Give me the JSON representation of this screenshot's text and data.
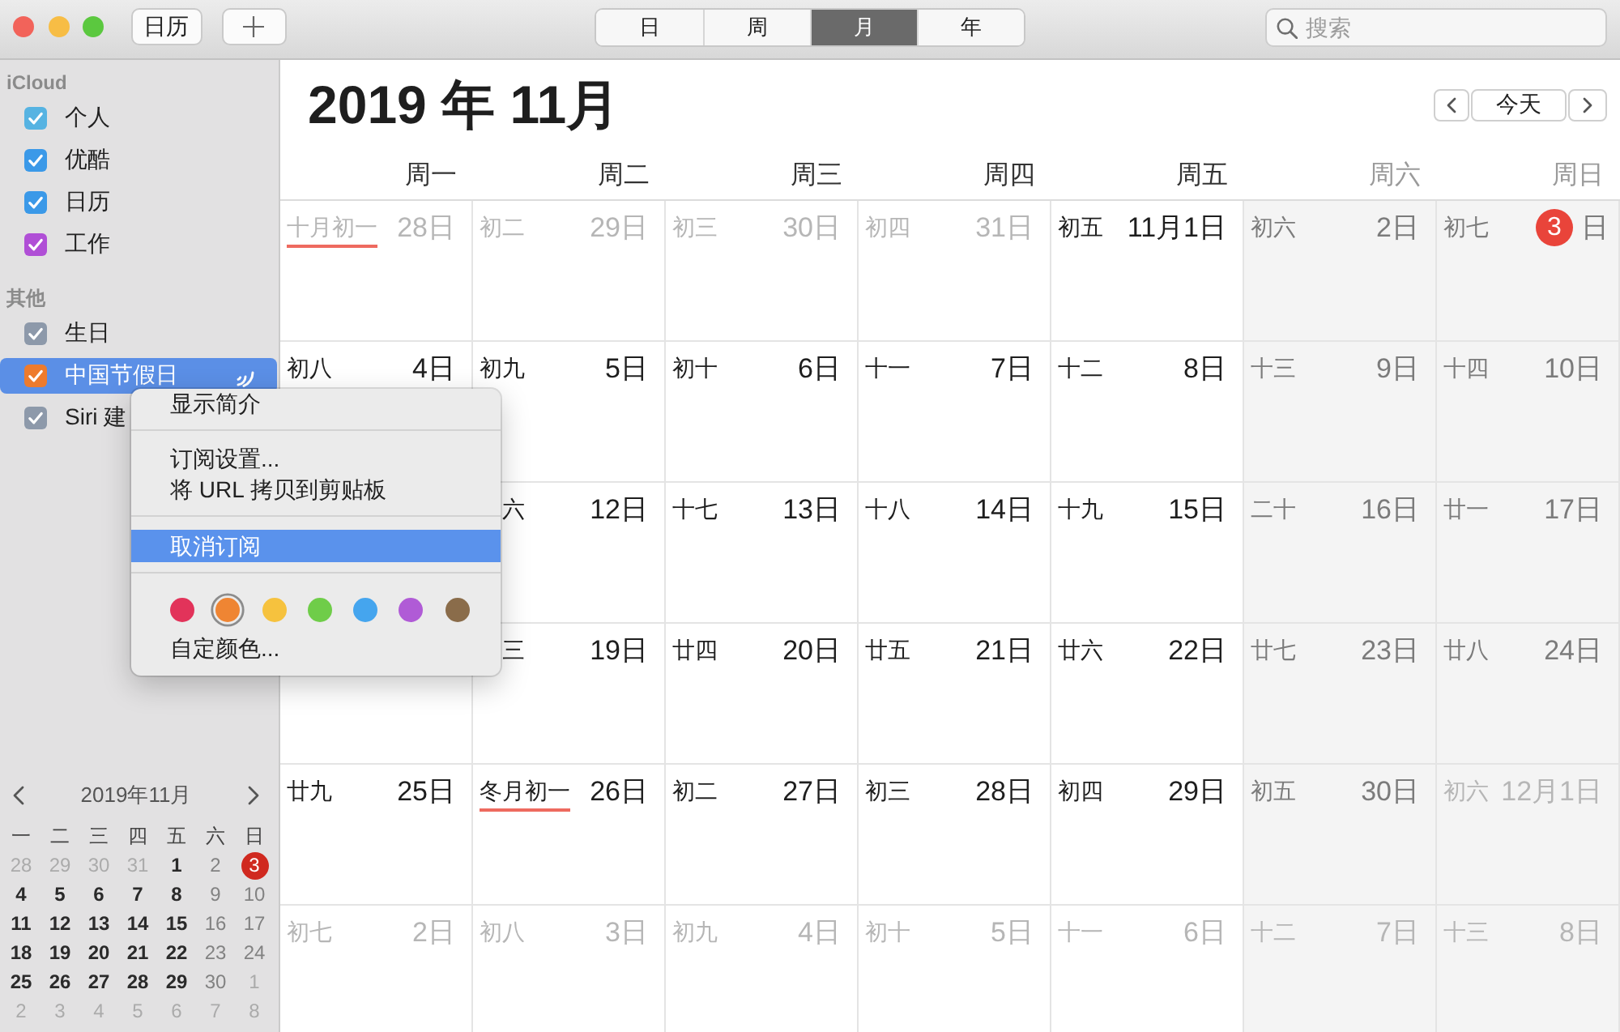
{
  "toolbar": {
    "calendars_button": "日历",
    "view_tabs": [
      {
        "label": "日",
        "selected": false
      },
      {
        "label": "周",
        "selected": false
      },
      {
        "label": "月",
        "selected": true
      },
      {
        "label": "年",
        "selected": false
      }
    ],
    "search": {
      "placeholder": "搜索"
    }
  },
  "sidebar": {
    "groups": [
      {
        "title": "iCloud",
        "items": [
          {
            "label": "个人",
            "checked": true,
            "color": "#56b3e2",
            "selected": false,
            "subscribed": false
          },
          {
            "label": "优酷",
            "checked": true,
            "color": "#3b99e8",
            "selected": false,
            "subscribed": false
          },
          {
            "label": "日历",
            "checked": true,
            "color": "#3b99e8",
            "selected": false,
            "subscribed": false
          },
          {
            "label": "工作",
            "checked": true,
            "color": "#b04fd6",
            "selected": false,
            "subscribed": false
          }
        ]
      },
      {
        "title": "其他",
        "items": [
          {
            "label": "生日",
            "checked": true,
            "color": "#8d99aa",
            "selected": false,
            "subscribed": false
          },
          {
            "label": "中国节假日",
            "checked": true,
            "color": "#ee7b2d",
            "selected": true,
            "subscribed": true
          },
          {
            "label": "Siri 建",
            "checked": true,
            "color": "#8d99aa",
            "selected": false,
            "subscribed": false
          }
        ]
      }
    ],
    "mini_calendar": {
      "title": "2019年11月",
      "weekdays": [
        {
          "label": "一",
          "weekend": false
        },
        {
          "label": "二",
          "weekend": false
        },
        {
          "label": "三",
          "weekend": false
        },
        {
          "label": "四",
          "weekend": false
        },
        {
          "label": "五",
          "weekend": false
        },
        {
          "label": "六",
          "weekend": true
        },
        {
          "label": "日",
          "weekend": true
        }
      ],
      "weeks": [
        [
          {
            "day": "28",
            "in_month": false,
            "today": false
          },
          {
            "day": "29",
            "in_month": false,
            "today": false
          },
          {
            "day": "30",
            "in_month": false,
            "today": false
          },
          {
            "day": "31",
            "in_month": false,
            "today": false
          },
          {
            "day": "1",
            "in_month": true,
            "today": false
          },
          {
            "day": "2",
            "in_month": true,
            "today": false
          },
          {
            "day": "3",
            "in_month": true,
            "today": true
          }
        ],
        [
          {
            "day": "4",
            "in_month": true,
            "today": false
          },
          {
            "day": "5",
            "in_month": true,
            "today": false
          },
          {
            "day": "6",
            "in_month": true,
            "today": false
          },
          {
            "day": "7",
            "in_month": true,
            "today": false
          },
          {
            "day": "8",
            "in_month": true,
            "today": false
          },
          {
            "day": "9",
            "in_month": true,
            "today": false
          },
          {
            "day": "10",
            "in_month": true,
            "today": false
          }
        ],
        [
          {
            "day": "11",
            "in_month": true,
            "today": false
          },
          {
            "day": "12",
            "in_month": true,
            "today": false
          },
          {
            "day": "13",
            "in_month": true,
            "today": false
          },
          {
            "day": "14",
            "in_month": true,
            "today": false
          },
          {
            "day": "15",
            "in_month": true,
            "today": false
          },
          {
            "day": "16",
            "in_month": true,
            "today": false
          },
          {
            "day": "17",
            "in_month": true,
            "today": false
          }
        ],
        [
          {
            "day": "18",
            "in_month": true,
            "today": false
          },
          {
            "day": "19",
            "in_month": true,
            "today": false
          },
          {
            "day": "20",
            "in_month": true,
            "today": false
          },
          {
            "day": "21",
            "in_month": true,
            "today": false
          },
          {
            "day": "22",
            "in_month": true,
            "today": false
          },
          {
            "day": "23",
            "in_month": true,
            "today": false
          },
          {
            "day": "24",
            "in_month": true,
            "today": false
          }
        ],
        [
          {
            "day": "25",
            "in_month": true,
            "today": false
          },
          {
            "day": "26",
            "in_month": true,
            "today": false
          },
          {
            "day": "27",
            "in_month": true,
            "today": false
          },
          {
            "day": "28",
            "in_month": true,
            "today": false
          },
          {
            "day": "29",
            "in_month": true,
            "today": false
          },
          {
            "day": "30",
            "in_month": true,
            "today": false
          },
          {
            "day": "1",
            "in_month": false,
            "today": false
          }
        ],
        [
          {
            "day": "2",
            "in_month": false,
            "today": false
          },
          {
            "day": "3",
            "in_month": false,
            "today": false
          },
          {
            "day": "4",
            "in_month": false,
            "today": false
          },
          {
            "day": "5",
            "in_month": false,
            "today": false
          },
          {
            "day": "6",
            "in_month": false,
            "today": false
          },
          {
            "day": "7",
            "in_month": false,
            "today": false
          },
          {
            "day": "8",
            "in_month": false,
            "today": false
          }
        ]
      ]
    }
  },
  "calendar": {
    "title": "2019 年 11月",
    "today_button": "今天",
    "weekdays": [
      {
        "label": "周一",
        "weekend": false
      },
      {
        "label": "周二",
        "weekend": false
      },
      {
        "label": "周三",
        "weekend": false
      },
      {
        "label": "周四",
        "weekend": false
      },
      {
        "label": "周五",
        "weekend": false
      },
      {
        "label": "周六",
        "weekend": true
      },
      {
        "label": "周日",
        "weekend": true
      }
    ],
    "weeks": [
      [
        {
          "lunar": "十月初一",
          "date": "28日",
          "in_month": false,
          "today": false,
          "underlined": true
        },
        {
          "lunar": "初二",
          "date": "29日",
          "in_month": false,
          "today": false,
          "underlined": false
        },
        {
          "lunar": "初三",
          "date": "30日",
          "in_month": false,
          "today": false,
          "underlined": false
        },
        {
          "lunar": "初四",
          "date": "31日",
          "in_month": false,
          "today": false,
          "underlined": false
        },
        {
          "lunar": "初五",
          "date": "11月1日",
          "in_month": true,
          "today": false,
          "underlined": false
        },
        {
          "lunar": "初六",
          "date": "2日",
          "in_month": true,
          "today": false,
          "underlined": false
        },
        {
          "lunar": "初七",
          "date": "3",
          "suffix": "日",
          "in_month": true,
          "today": true,
          "underlined": false
        }
      ],
      [
        {
          "lunar": "初八",
          "date": "4日",
          "in_month": true,
          "today": false,
          "underlined": false
        },
        {
          "lunar": "初九",
          "date": "5日",
          "in_month": true,
          "today": false,
          "underlined": false
        },
        {
          "lunar": "初十",
          "date": "6日",
          "in_month": true,
          "today": false,
          "underlined": false
        },
        {
          "lunar": "十一",
          "date": "7日",
          "in_month": true,
          "today": false,
          "underlined": false
        },
        {
          "lunar": "十二",
          "date": "8日",
          "in_month": true,
          "today": false,
          "underlined": false
        },
        {
          "lunar": "十三",
          "date": "9日",
          "in_month": true,
          "today": false,
          "underlined": false
        },
        {
          "lunar": "十四",
          "date": "10日",
          "in_month": true,
          "today": false,
          "underlined": false
        }
      ],
      [
        {
          "lunar": "六",
          "date": "12日",
          "in_month": true,
          "today": false,
          "underlined": false
        },
        {
          "lunar": "十七",
          "date": "13日",
          "in_month": true,
          "today": false,
          "underlined": false
        },
        {
          "lunar": "十八",
          "date": "14日",
          "in_month": true,
          "today": false,
          "underlined": false
        },
        {
          "lunar": "十九",
          "date": "15日",
          "in_month": true,
          "today": false,
          "underlined": false
        },
        {
          "lunar": "二十",
          "date": "16日",
          "in_month": true,
          "today": false,
          "underlined": false
        },
        {
          "lunar": "廿一",
          "date": "17日",
          "in_month": true,
          "today": false,
          "underlined": false
        }
      ],
      [
        {
          "lunar": "三",
          "date": "19日",
          "in_month": true,
          "today": false,
          "underlined": false
        },
        {
          "lunar": "廿四",
          "date": "20日",
          "in_month": true,
          "today": false,
          "underlined": false
        },
        {
          "lunar": "廿五",
          "date": "21日",
          "in_month": true,
          "today": false,
          "underlined": false
        },
        {
          "lunar": "廿六",
          "date": "22日",
          "in_month": true,
          "today": false,
          "underlined": false
        },
        {
          "lunar": "廿七",
          "date": "23日",
          "in_month": true,
          "today": false,
          "underlined": false
        },
        {
          "lunar": "廿八",
          "date": "24日",
          "in_month": true,
          "today": false,
          "underlined": false
        }
      ],
      [
        {
          "lunar": "廿九",
          "date": "25日",
          "in_month": true,
          "today": false,
          "underlined": false
        },
        {
          "lunar": "冬月初一",
          "date": "26日",
          "in_month": true,
          "today": false,
          "underlined": true
        },
        {
          "lunar": "初二",
          "date": "27日",
          "in_month": true,
          "today": false,
          "underlined": false
        },
        {
          "lunar": "初三",
          "date": "28日",
          "in_month": true,
          "today": false,
          "underlined": false
        },
        {
          "lunar": "初四",
          "date": "29日",
          "in_month": true,
          "today": false,
          "underlined": false
        },
        {
          "lunar": "初五",
          "date": "30日",
          "in_month": true,
          "today": false,
          "underlined": false
        },
        {
          "lunar": "初六",
          "date": "12月1日",
          "in_month": false,
          "today": false,
          "underlined": false
        }
      ],
      [
        {
          "lunar": "初七",
          "date": "2日",
          "in_month": false,
          "today": false,
          "underlined": false
        },
        {
          "lunar": "初八",
          "date": "3日",
          "in_month": false,
          "today": false,
          "underlined": false
        },
        {
          "lunar": "初九",
          "date": "4日",
          "in_month": false,
          "today": false,
          "underlined": false
        },
        {
          "lunar": "初十",
          "date": "5日",
          "in_month": false,
          "today": false,
          "underlined": false
        },
        {
          "lunar": "十一",
          "date": "6日",
          "in_month": false,
          "today": false,
          "underlined": false
        },
        {
          "lunar": "十二",
          "date": "7日",
          "in_month": false,
          "today": false,
          "underlined": false
        },
        {
          "lunar": "十三",
          "date": "8日",
          "in_month": false,
          "today": false,
          "underlined": false
        }
      ]
    ]
  },
  "context_menu": {
    "items": [
      {
        "kind": "item",
        "label": "显示简介",
        "selected": false
      },
      {
        "kind": "separator"
      },
      {
        "kind": "item",
        "label": "订阅设置...",
        "selected": false
      },
      {
        "kind": "item",
        "label": "将 URL 拷贝到剪贴板",
        "selected": false
      },
      {
        "kind": "separator"
      },
      {
        "kind": "item",
        "label": "取消订阅",
        "selected": true
      },
      {
        "kind": "separator"
      },
      {
        "kind": "colors",
        "swatches": [
          {
            "color": "#e2335a",
            "selected": false
          },
          {
            "color": "#ef8533",
            "selected": true
          },
          {
            "color": "#f6c23e",
            "selected": false
          },
          {
            "color": "#6fcd49",
            "selected": false
          },
          {
            "color": "#45a5ee",
            "selected": false
          },
          {
            "color": "#b05bd6",
            "selected": false
          },
          {
            "color": "#8a6c4a",
            "selected": false
          }
        ]
      },
      {
        "kind": "item",
        "label": "自定颜色...",
        "selected": false
      }
    ]
  }
}
